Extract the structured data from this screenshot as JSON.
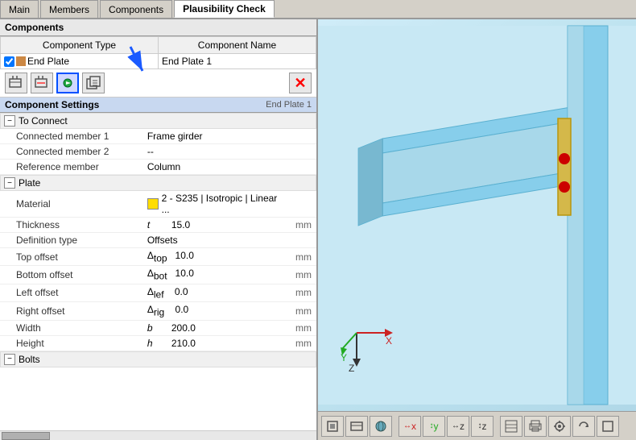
{
  "tabs": [
    {
      "label": "Main",
      "active": false
    },
    {
      "label": "Members",
      "active": false
    },
    {
      "label": "Components",
      "active": false
    },
    {
      "label": "Plausibility Check",
      "active": true
    }
  ],
  "left_panel": {
    "components_header": "Components",
    "table": {
      "col1": "Component Type",
      "col2": "Component Name",
      "rows": [
        {
          "checked": true,
          "type": "End Plate",
          "name": "End Plate 1"
        }
      ]
    },
    "toolbar": {
      "btn1": "⊞",
      "btn2": "⊟",
      "btn3": "⊙",
      "btn4": "⊗",
      "delete": "✕"
    },
    "settings": {
      "title": "Component Settings",
      "subtitle": "End Plate 1",
      "sections": [
        {
          "name": "To Connect",
          "collapsed": false,
          "properties": [
            {
              "label": "Connected member 1",
              "symbol": "",
              "value": "Frame girder",
              "unit": ""
            },
            {
              "label": "Connected member 2",
              "symbol": "",
              "value": "--",
              "unit": ""
            },
            {
              "label": "Reference member",
              "symbol": "",
              "value": "Column",
              "unit": ""
            }
          ]
        },
        {
          "name": "Plate",
          "collapsed": false,
          "properties": [
            {
              "label": "Material",
              "symbol": "",
              "value": "2 - S235 | Isotropic | Linear ...",
              "unit": "",
              "has_color": true
            },
            {
              "label": "Thickness",
              "symbol": "t",
              "value": "15.0",
              "unit": "mm"
            },
            {
              "label": "Definition type",
              "symbol": "",
              "value": "Offsets",
              "unit": ""
            },
            {
              "label": "Top offset",
              "symbol": "Δtop",
              "value": "10.0",
              "unit": "mm"
            },
            {
              "label": "Bottom offset",
              "symbol": "Δbot",
              "value": "10.0",
              "unit": "mm"
            },
            {
              "label": "Left offset",
              "symbol": "Δlef",
              "value": "0.0",
              "unit": "mm"
            },
            {
              "label": "Right offset",
              "symbol": "Δrig",
              "value": "0.0",
              "unit": "mm"
            },
            {
              "label": "Width",
              "symbol": "b",
              "value": "200.0",
              "unit": "mm"
            },
            {
              "label": "Height",
              "symbol": "h",
              "value": "210.0",
              "unit": "mm"
            }
          ]
        },
        {
          "name": "Bolts",
          "collapsed": false,
          "properties": []
        }
      ]
    }
  },
  "viewport": {
    "bottom_buttons": [
      "⊞",
      "↔",
      "↕",
      "↔z",
      "↕z",
      "↔↕",
      "◉",
      "⊟",
      "≡",
      "✕",
      "↺",
      "□"
    ]
  }
}
